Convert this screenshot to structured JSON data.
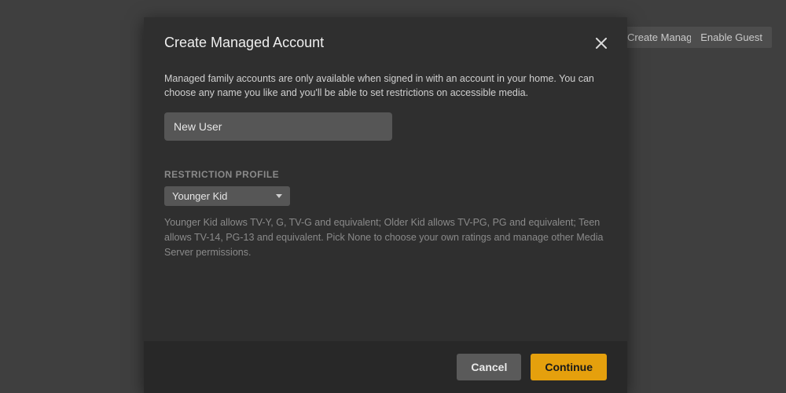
{
  "background_buttons": {
    "managed_account": "Create Managed Account",
    "enable_guest": "Enable Guest"
  },
  "modal": {
    "title": "Create Managed Account",
    "intro": "Managed family accounts are only available when signed in with an account in your home. You can choose any name you like and you'll be able to set restrictions on accessible media.",
    "name_input": {
      "value": "New User",
      "placeholder": "New User"
    },
    "restriction": {
      "label": "RESTRICTION PROFILE",
      "selected": "Younger Kid",
      "help": "Younger Kid allows TV-Y, G, TV-G and equivalent; Older Kid allows TV-PG, PG and equivalent; Teen allows TV-14, PG-13 and equivalent. Pick None to choose your own ratings and manage other Media Server permissions."
    },
    "footer": {
      "cancel": "Cancel",
      "continue": "Continue"
    }
  }
}
